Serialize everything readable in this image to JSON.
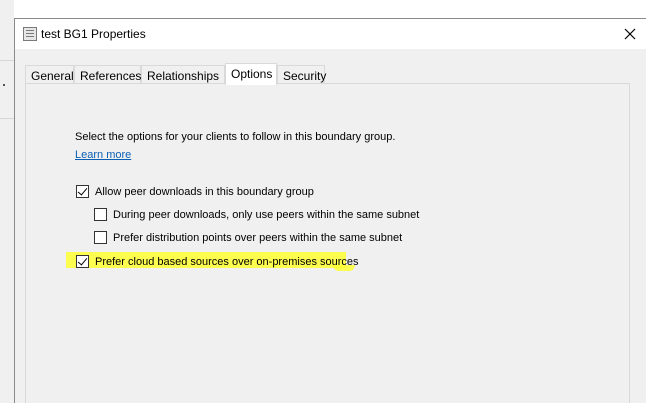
{
  "window": {
    "title": "test BG1 Properties",
    "close_glyph": "✕",
    "icon": "properties-icon",
    "close_icon": "close-icon"
  },
  "tabs": [
    {
      "label": "General",
      "active": false
    },
    {
      "label": "References",
      "active": false
    },
    {
      "label": "Relationships",
      "active": false
    },
    {
      "label": "Options",
      "active": true
    },
    {
      "label": "Security",
      "active": false
    }
  ],
  "options": {
    "description": "Select the options for your clients to follow in this boundary group.",
    "learn_more": "Learn more",
    "checkboxes": [
      {
        "label": "Allow peer downloads in this boundary group",
        "checked": true
      },
      {
        "label": "During peer downloads, only use peers within the same subnet",
        "checked": false
      },
      {
        "label": "Prefer distribution points over peers within the same subnet",
        "checked": false
      },
      {
        "label": "Prefer cloud based sources over on-premises sources",
        "checked": true
      }
    ]
  },
  "colors": {
    "highlight": "#ffff33",
    "link": "#0a5fb4",
    "dialog_bg": "#f0f0f0"
  }
}
